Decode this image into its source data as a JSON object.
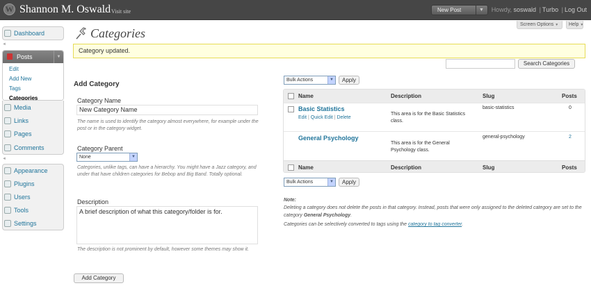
{
  "header": {
    "logo_glyph": "W",
    "site_title": "Shannon M. Oswald",
    "visit_site_dash": "—",
    "visit_site": "Visit site",
    "new_post": "New Post",
    "howdy": "Howdy,",
    "username": "soswald",
    "separator": "|",
    "turbo": "Turbo",
    "logout": "Log Out"
  },
  "screen_options": {
    "label": "Screen Options",
    "help": "Help"
  },
  "menu": {
    "dashboard": "Dashboard",
    "posts": "Posts",
    "posts_sub": [
      "Edit",
      "Add New",
      "Tags",
      "Categories"
    ],
    "items": [
      "Media",
      "Links",
      "Pages",
      "Comments"
    ],
    "items2": [
      "Appearance",
      "Plugins",
      "Users",
      "Tools",
      "Settings"
    ]
  },
  "page": {
    "title": "Categories",
    "notice": "Category updated."
  },
  "search": {
    "button": "Search Categories",
    "value": ""
  },
  "add_form": {
    "heading": "Add Category",
    "name_label": "Category Name",
    "name_value": "New Category Name",
    "name_help": "The name is used to identify the category almost everywhere, for example under the post or in the category widget.",
    "parent_label": "Category Parent",
    "parent_value": "None",
    "parent_help": "Categories, unlike tags, can have a hierarchy. You might have a Jazz category, and under that have children categories for Bebop and Big Band. Totally optional.",
    "desc_label": "Description",
    "desc_value": "A brief description of what this category/folder is for.",
    "desc_help": "The description is not prominent by default, however some themes may show it.",
    "submit": "Add Category"
  },
  "bulk": {
    "label": "Bulk Actions",
    "apply": "Apply"
  },
  "table": {
    "columns": {
      "name": "Name",
      "description": "Description",
      "slug": "Slug",
      "posts": "Posts"
    },
    "rows": [
      {
        "name": "Basic Statistics",
        "description": "This area is for the Basic Statistics class.",
        "slug": "basic-statistics",
        "posts": "0",
        "actions": {
          "edit": "Edit",
          "quick_edit": "Quick Edit",
          "delete": "Delete",
          "sep": "|"
        }
      },
      {
        "name": "General Psychology",
        "description": "This area is for the General Psychology class.",
        "slug": "general-psychology",
        "posts": "2"
      }
    ]
  },
  "note": {
    "title": "Note:",
    "line1_a": "Deleting a category does not delete the posts in that category. Instead, posts that were only assigned to the deleted category are set to the category",
    "line1_b": "General Psychology",
    "line1_c": ".",
    "line2_a": "Categories can be selectively converted to tags using the",
    "line2_link": "category to tag converter",
    "line2_b": "."
  },
  "colors": {
    "header_bg": "#464646",
    "notice_bg": "#ffffe0",
    "link": "#21759b"
  }
}
